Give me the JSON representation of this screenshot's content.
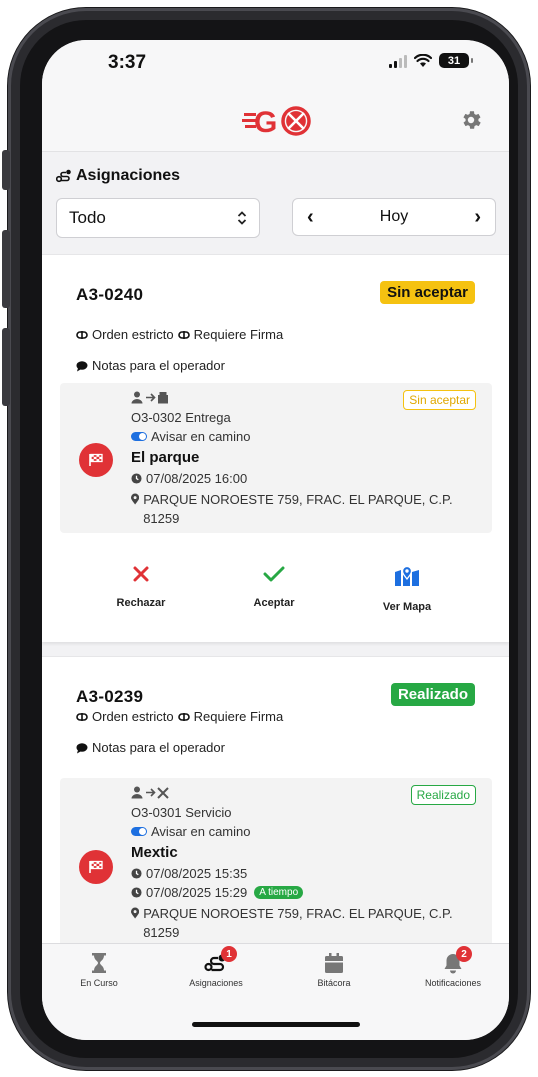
{
  "status_bar": {
    "time": "3:37",
    "battery": "31"
  },
  "header": {
    "logo_icon": "g-logo-icon",
    "settings_icon": "gear-icon"
  },
  "section": {
    "title": "Asignaciones",
    "icon": "route-icon"
  },
  "filter": {
    "value": "Todo"
  },
  "date_nav": {
    "label": "Hoy",
    "prev": "‹",
    "next": "›"
  },
  "colors": {
    "accent_red": "#e03236",
    "warn": "#f5c211",
    "success": "#27a844",
    "blue": "#1d6fe0"
  },
  "assignments": [
    {
      "code": "A3-0240",
      "status": "Sin aceptar",
      "tags": [
        "Orden estricto",
        "Requiere Firma"
      ],
      "notes": "Notas para el operador",
      "stop": {
        "type_icon": "person-arrow-box-icon",
        "order": "O3-0302 Entrega",
        "notify": "Avisar en camino",
        "name": "El parque",
        "scheduled": "07/08/2025 16:00",
        "address": "PARQUE NOROESTE 759, FRAC. EL PARQUE, C.P. 81259",
        "status": "Sin aceptar"
      },
      "actions": [
        {
          "label": "Rechazar",
          "icon": "x-icon"
        },
        {
          "label": "Aceptar",
          "icon": "check-icon"
        },
        {
          "label": "Ver Mapa",
          "icon": "map-pin-icon"
        }
      ]
    },
    {
      "code": "A3-0239",
      "status": "Realizado",
      "tags": [
        "Orden estricto",
        "Requiere Firma"
      ],
      "notes": "Notas para el operador",
      "stop": {
        "type_icon": "person-arrow-tools-icon",
        "order": "O3-0301 Servicio",
        "notify": "Avisar en camino",
        "name": "Mextic",
        "scheduled": "07/08/2025 15:35",
        "completed": "07/08/2025 15:29",
        "timing": "A tiempo",
        "address": "PARQUE NOROESTE 759, FRAC. EL PARQUE, C.P. 81259",
        "status": "Realizado"
      }
    }
  ],
  "bottom_nav": [
    {
      "label": "En Curso",
      "icon": "hourglass-icon"
    },
    {
      "label": "Asignaciones",
      "icon": "route-icon",
      "badge": "1"
    },
    {
      "label": "Bitácora",
      "icon": "calendar-icon"
    },
    {
      "label": "Notificaciones",
      "icon": "bell-icon",
      "badge": "2"
    }
  ]
}
